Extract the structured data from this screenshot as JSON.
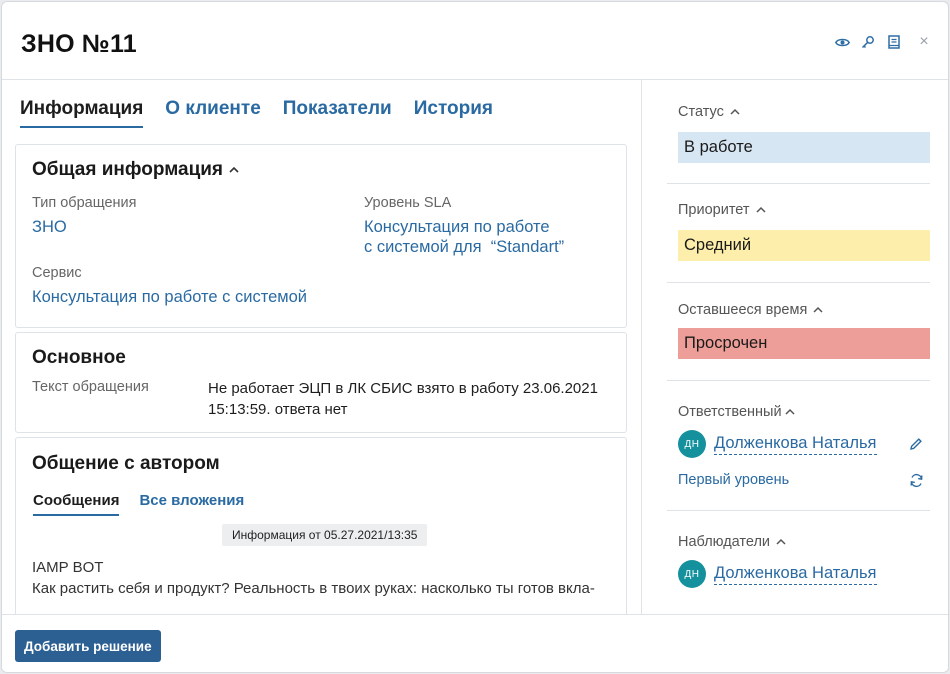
{
  "header": {
    "title": "ЗНО №11",
    "icons": [
      "eye-icon",
      "key-icon",
      "book-icon",
      "close-icon"
    ],
    "close_glyph": "×"
  },
  "tabs": [
    {
      "label": "Информация",
      "active": true
    },
    {
      "label": "О клиенте",
      "active": false
    },
    {
      "label": "Показатели",
      "active": false
    },
    {
      "label": "История",
      "active": false
    }
  ],
  "general": {
    "title": "Общая информация",
    "type_label": "Тип обращения",
    "type_value": "ЗНО",
    "sla_label": "Уровень SLA",
    "sla_value_line1": "Консультация по работе",
    "sla_value_line2": "с системой для  “Standart”",
    "service_label": "Сервис",
    "service_value": "Консультация по работе с системой"
  },
  "main": {
    "title": "Основное",
    "text_label": "Текст обращения",
    "text_line1": "Не работает ЭЦП в ЛК СБИС взято в работу 23.06.2021",
    "text_line2": "15:13:59. ответа нет"
  },
  "communication": {
    "title": "Общение с автором",
    "tabs": [
      {
        "label": "Сообщения",
        "active": true
      },
      {
        "label": "Все вложения",
        "active": false
      }
    ],
    "chip": "Информация от 05.27.2021/13:35",
    "author": "IAMP BOT",
    "message": "Как растить себя и продукт? Реальность в твоих руках: насколько ты готов вкла-"
  },
  "sidebar": {
    "status_label": "Статус",
    "status_value": "В работе",
    "priority_label": "Приоритет",
    "priority_value": "Средний",
    "remaining_label": "Оставшееся время",
    "remaining_value": "Просрочен",
    "responsible_label": "Ответственный",
    "responsible_initials": "ДН",
    "responsible_name": "Долженкова Наталья",
    "responsible_level": "Первый уровень",
    "watchers_label": "Наблюдатели",
    "watcher_initials": "ДН",
    "watcher_name": "Долженкова Наталья"
  },
  "colors": {
    "status": "#d6e6f3",
    "priority": "#fdeeab",
    "remaining": "#ee9e98",
    "accent": "#2a6aa2",
    "button": "#2c5f92",
    "avatar": "#15919e"
  },
  "footer": {
    "primary_button": "Добавить решение"
  }
}
